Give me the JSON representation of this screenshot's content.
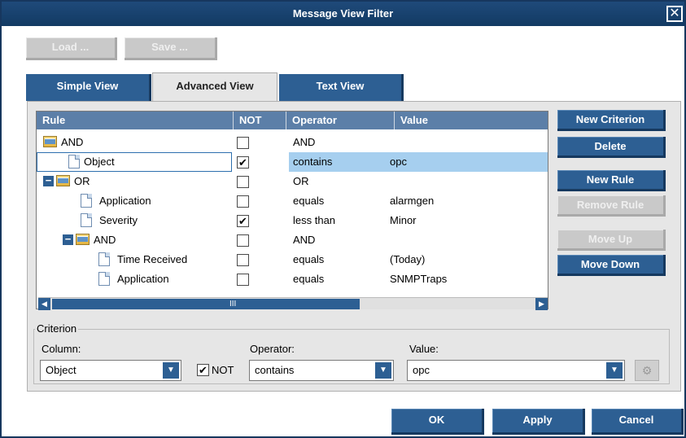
{
  "window": {
    "title": "Message View Filter",
    "close_icon": "close-icon"
  },
  "toolbar": {
    "load_label": "Load ...",
    "save_label": "Save ..."
  },
  "tabs": [
    {
      "label": "Simple View",
      "active": false
    },
    {
      "label": "Advanced View",
      "active": true
    },
    {
      "label": "Text View",
      "active": false
    }
  ],
  "grid": {
    "columns": [
      "Rule",
      "NOT",
      "Operator",
      "Value"
    ],
    "rows": [
      {
        "rule": "AND",
        "icon": "folder",
        "not": false,
        "operator": "AND",
        "value": ""
      },
      {
        "rule": "Object",
        "icon": "document",
        "not": true,
        "operator": "contains",
        "value": "opc"
      },
      {
        "rule": "OR",
        "icon": "folder",
        "not": false,
        "operator": "OR",
        "value": ""
      },
      {
        "rule": "Application",
        "icon": "document",
        "not": false,
        "operator": "equals",
        "value": "alarmgen"
      },
      {
        "rule": "Severity",
        "icon": "document",
        "not": true,
        "operator": "less than",
        "value": "Minor"
      },
      {
        "rule": "AND",
        "icon": "folder",
        "not": false,
        "operator": "AND",
        "value": ""
      },
      {
        "rule": "Time Received",
        "icon": "document",
        "not": false,
        "operator": "equals",
        "value": "(Today)"
      },
      {
        "rule": "Application",
        "icon": "document",
        "not": false,
        "operator": "equals",
        "value": "SNMPTraps"
      }
    ],
    "selected_row": 1,
    "scroll_grip": "III"
  },
  "side_buttons": {
    "new_criterion": "New Criterion",
    "delete": "Delete",
    "new_rule": "New Rule",
    "remove_rule": "Remove Rule",
    "move_up": "Move Up",
    "move_down": "Move Down"
  },
  "criterion": {
    "legend": "Criterion",
    "column_label": "Column:",
    "column_value": "Object",
    "not_label": "NOT",
    "not_checked": "✔",
    "operator_label": "Operator:",
    "operator_value": "contains",
    "value_label": "Value:",
    "value_value": "opc"
  },
  "footer": {
    "ok": "OK",
    "apply": "Apply",
    "cancel": "Cancel"
  },
  "colors": {
    "brand": "#2d5f93",
    "selected_row": "#a6cfef",
    "header": "#5c7fa8"
  }
}
